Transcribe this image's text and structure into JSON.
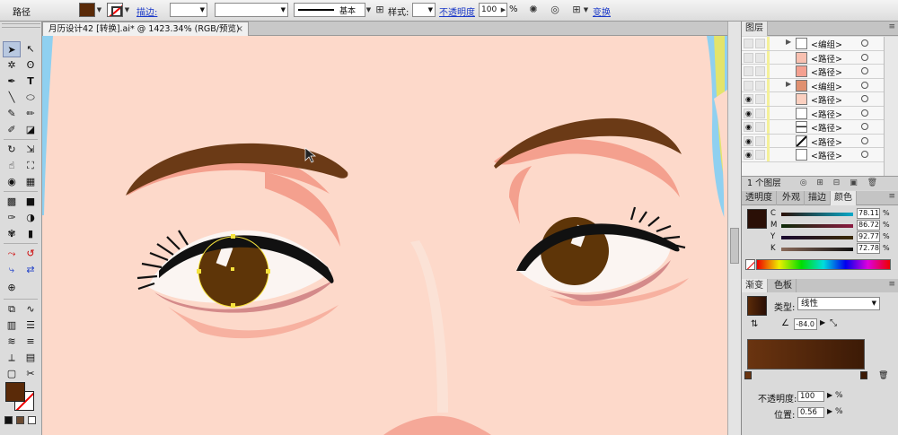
{
  "control_bar": {
    "selection_label": "路径",
    "stroke_label": "描边:",
    "stroke_profile": "基本",
    "style_label": "样式:",
    "opacity_label": "不透明度",
    "opacity_value": "100",
    "opacity_unit": "%",
    "transform_label": "变换"
  },
  "document": {
    "tab_title": "月历设计42 [转换].ai* @ 1423.34% (RGB/预览)",
    "close_glyph": "×"
  },
  "tools": {
    "icons": [
      "selection-tool",
      "direct-selection-tool",
      "magic-wand-tool",
      "lasso-tool",
      "pen-tool",
      "type-tool",
      "line-tool",
      "ellipse-tool",
      "paintbrush-tool",
      "pencil-tool",
      "blob-brush-tool",
      "eraser-tool",
      "rotate-tool",
      "scale-tool",
      "warp-tool",
      "free-transform-tool",
      "shape-builder-tool",
      "perspective-tool",
      "mesh-tool",
      "gradient-tool",
      "eyedropper-tool",
      "blend-tool",
      "symbol-sprayer-tool",
      "column-graph-tool",
      "artboard-tool",
      "slice-tool",
      "hand-tool",
      "zoom-tool"
    ]
  },
  "panels": {
    "layers": {
      "tab": "图层",
      "rows": [
        {
          "name": "<编组>",
          "eye": false,
          "expand": true
        },
        {
          "name": "<路径>",
          "eye": false,
          "expand": false
        },
        {
          "name": "<路径>",
          "eye": false,
          "expand": false
        },
        {
          "name": "<编组>",
          "eye": false,
          "expand": true
        },
        {
          "name": "<路径>",
          "eye": true,
          "expand": false
        },
        {
          "name": "<路径>",
          "eye": true,
          "expand": false
        },
        {
          "name": "<路径>",
          "eye": true,
          "expand": false
        },
        {
          "name": "<路径>",
          "eye": true,
          "expand": false
        },
        {
          "name": "<路径>",
          "eye": true,
          "expand": false
        }
      ],
      "footer": "1 个图层"
    },
    "color": {
      "tabs": [
        "透明度",
        "外观",
        "描边",
        "颜色"
      ],
      "channels": [
        {
          "label": "C",
          "value": "78.11",
          "unit": "%",
          "color": "#0aa8c8"
        },
        {
          "label": "M",
          "value": "86.72",
          "unit": "%",
          "color": "#c8107a"
        },
        {
          "label": "Y",
          "value": "92.77",
          "unit": "%",
          "color": "#d8c800"
        },
        {
          "label": "K",
          "value": "72.78",
          "unit": "%",
          "color": "#222222"
        }
      ]
    },
    "gradient": {
      "tabs": [
        "渐变",
        "色板"
      ],
      "type_label": "类型:",
      "type_value": "线性",
      "angle": "-84.0",
      "opacity_label": "不透明度:",
      "opacity_value": "100",
      "opacity_unit": "%",
      "position_label": "位置:",
      "position_value": "0.56",
      "position_unit": "%"
    }
  },
  "colors": {
    "fill": "#5a2a08",
    "skin": "#fdd9ca",
    "brow": "#6b3a16",
    "iris": "#5e3508",
    "lid_pink": "#f0988a",
    "selection": "#f4e23c"
  }
}
